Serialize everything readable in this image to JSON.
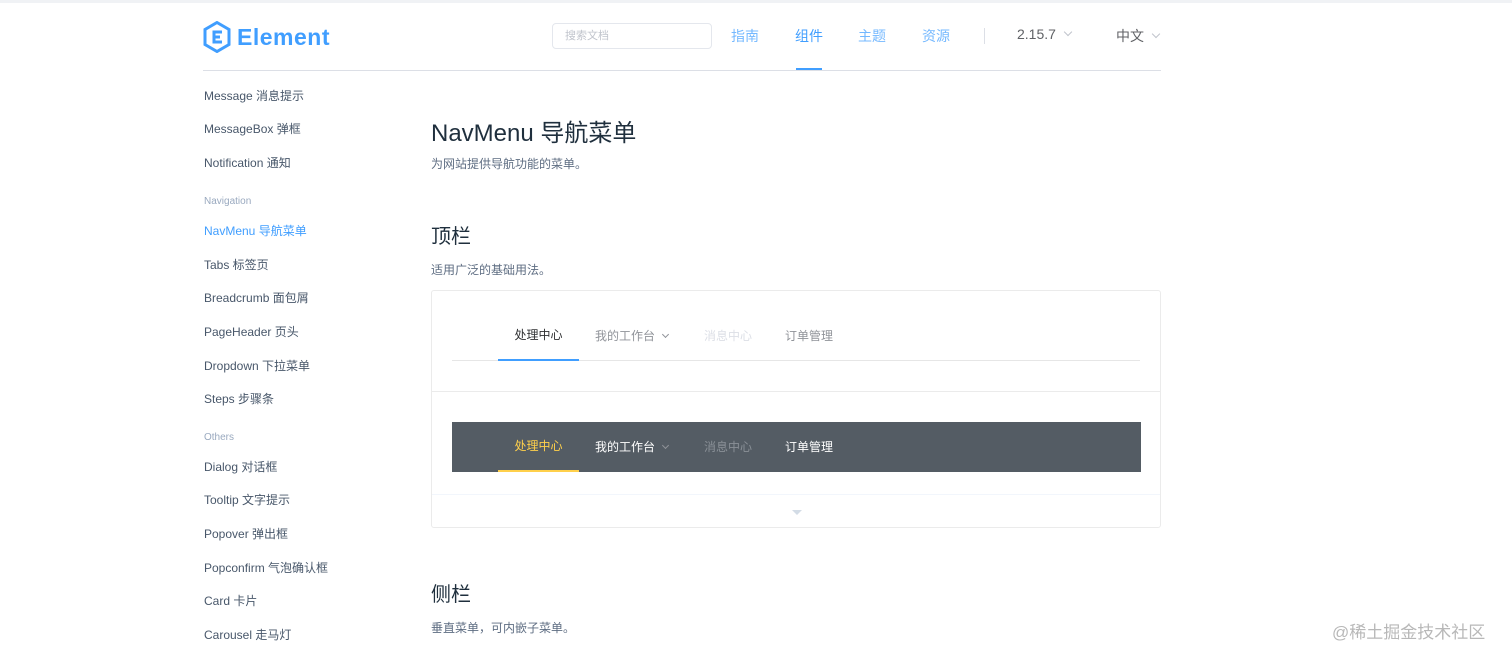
{
  "header": {
    "logo_text": "Element",
    "search_placeholder": "搜索文档",
    "nav": [
      "指南",
      "组件",
      "主题",
      "资源"
    ],
    "active_nav": "组件",
    "version": "2.15.7",
    "language": "中文"
  },
  "sidebar": {
    "items_top": [
      "Message 消息提示",
      "MessageBox 弹框",
      "Notification 通知"
    ],
    "group_navigation": "Navigation",
    "items_navigation": [
      "NavMenu 导航菜单",
      "Tabs 标签页",
      "Breadcrumb 面包屑",
      "PageHeader 页头",
      "Dropdown 下拉菜单",
      "Steps 步骤条"
    ],
    "group_others": "Others",
    "items_others": [
      "Dialog 对话框",
      "Tooltip 文字提示",
      "Popover 弹出框",
      "Popconfirm 气泡确认框",
      "Card 卡片",
      "Carousel 走马灯"
    ],
    "active_item": "NavMenu 导航菜单"
  },
  "main": {
    "title": "NavMenu 导航菜单",
    "description": "为网站提供导航功能的菜单。",
    "section1_title": "顶栏",
    "section1_desc": "适用广泛的基础用法。",
    "menu_items": [
      "处理中心",
      "我的工作台",
      "消息中心",
      "订单管理"
    ],
    "section2_title": "侧栏",
    "section2_desc": "垂直菜单，可内嵌子菜单。"
  },
  "colors": {
    "accent": "#409eff",
    "dark_menu_bg": "#545c64",
    "dark_menu_active": "#ffd04b"
  },
  "watermark": "@稀土掘金技术社区"
}
